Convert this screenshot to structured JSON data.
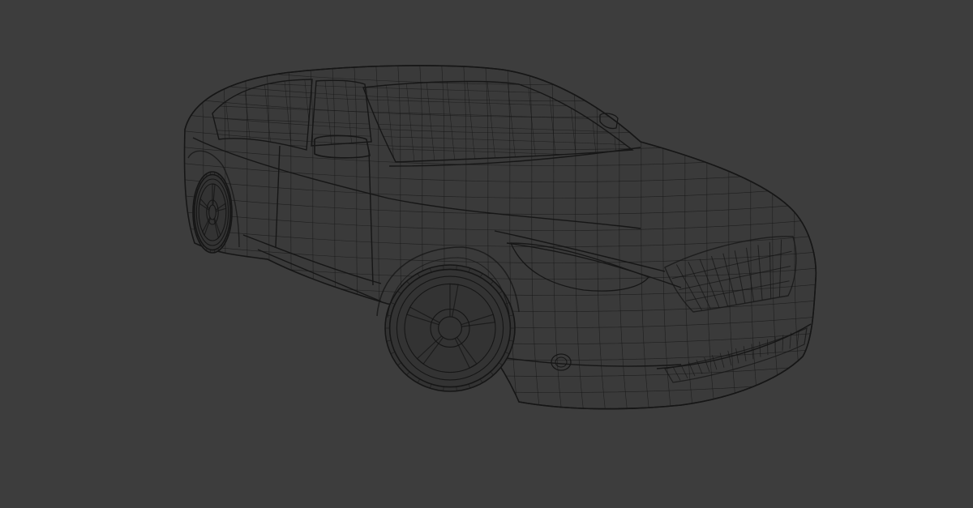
{
  "viewport": {
    "background_color": "#3d3d3d",
    "wire_color": "#161616",
    "subject": "car-wireframe-model"
  }
}
